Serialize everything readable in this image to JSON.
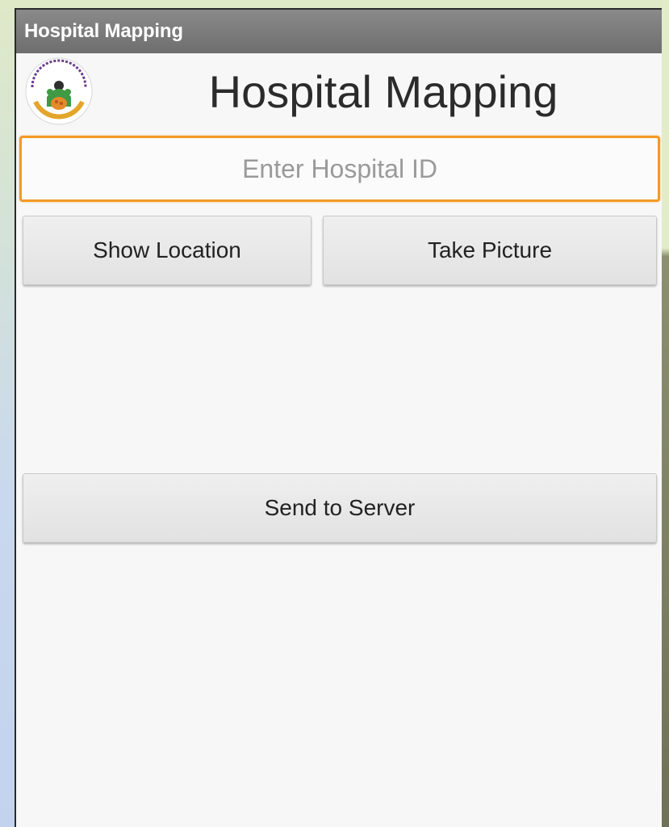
{
  "window": {
    "title": "Hospital Mapping"
  },
  "header": {
    "logo_icon": "government-health-emblem-icon",
    "title": "Hospital Mapping"
  },
  "form": {
    "hospital_id": {
      "value": "",
      "placeholder": "Enter Hospital ID"
    },
    "show_location_label": "Show Location",
    "take_picture_label": "Take Picture",
    "send_label": "Send to Server"
  },
  "colors": {
    "accent_focus": "#f29a25",
    "title_bar": "#7a7a7a",
    "button_bg": "#e9e9e9"
  }
}
